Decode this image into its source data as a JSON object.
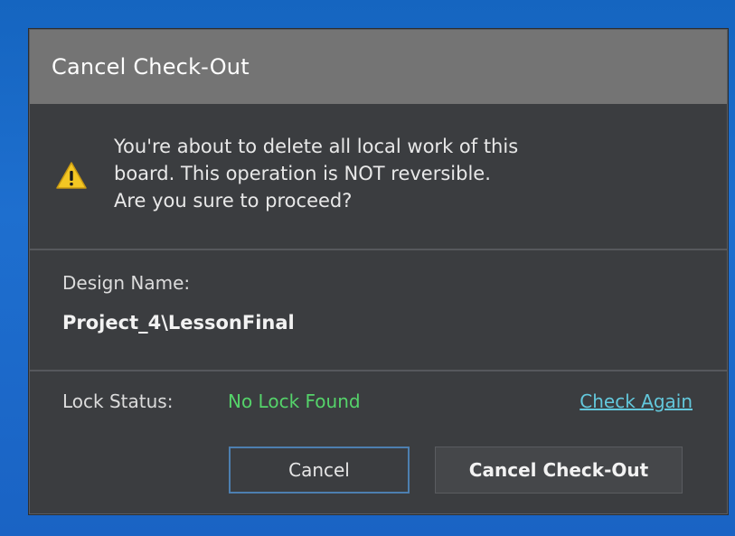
{
  "dialog": {
    "title": "Cancel Check-Out"
  },
  "warning": {
    "icon": "warning-icon",
    "line1": "You're about to delete all local work of this",
    "line2": "board. This operation is NOT reversible.",
    "line3": "Are you sure to proceed?"
  },
  "design": {
    "label": "Design Name:",
    "value": "Project_4\\LessonFinal"
  },
  "lock": {
    "label": "Lock Status:",
    "value": "No Lock Found",
    "value_color": "#55d36a",
    "check_again_label": "Check Again"
  },
  "buttons": {
    "cancel_label": "Cancel",
    "confirm_label": "Cancel Check-Out"
  },
  "colors": {
    "titlebar": "#747474",
    "dialog_bg": "#3b3d40",
    "link": "#63c8dc",
    "focus_border": "#4d7fb0"
  }
}
